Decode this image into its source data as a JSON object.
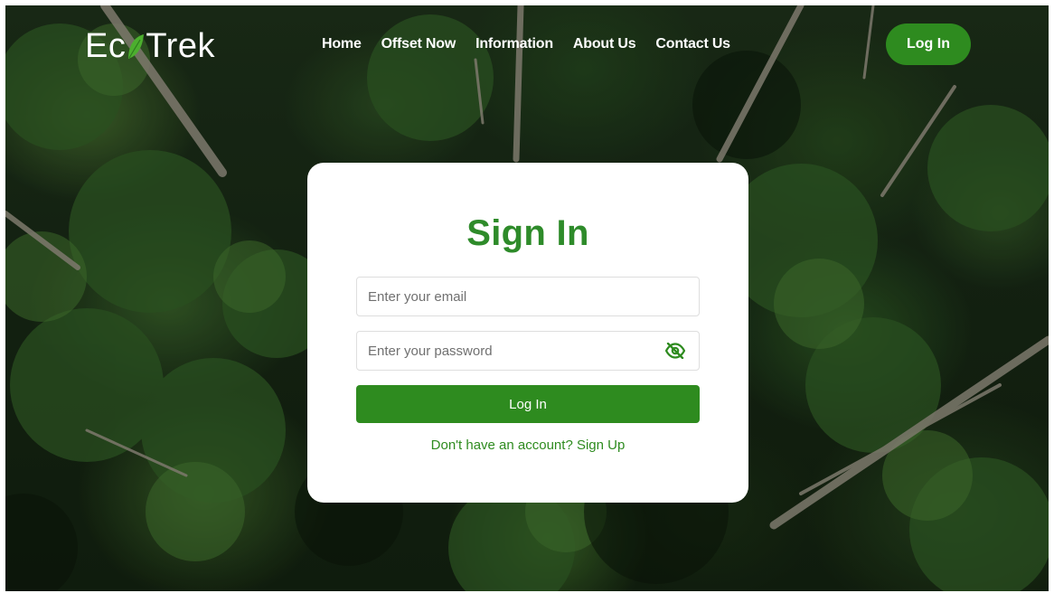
{
  "brand": {
    "name_part1": "Ec",
    "name_part2": "Trek",
    "accent": "#2e8b1f"
  },
  "nav": {
    "items": [
      {
        "label": "Home"
      },
      {
        "label": "Offset Now"
      },
      {
        "label": "Information"
      },
      {
        "label": "About Us"
      },
      {
        "label": "Contact Us"
      }
    ],
    "login_label": "Log In"
  },
  "signin": {
    "title": "Sign In",
    "email_placeholder": "Enter your email",
    "password_placeholder": "Enter your password",
    "password_toggle_icon": "eye-slash-icon",
    "submit_label": "Log In",
    "signup_prompt": "Don't have an account?",
    "signup_link": "Sign Up"
  },
  "colors": {
    "title_green": "#2e8b2a",
    "button_green": "#2e8b1f",
    "card_bg": "#ffffff"
  }
}
